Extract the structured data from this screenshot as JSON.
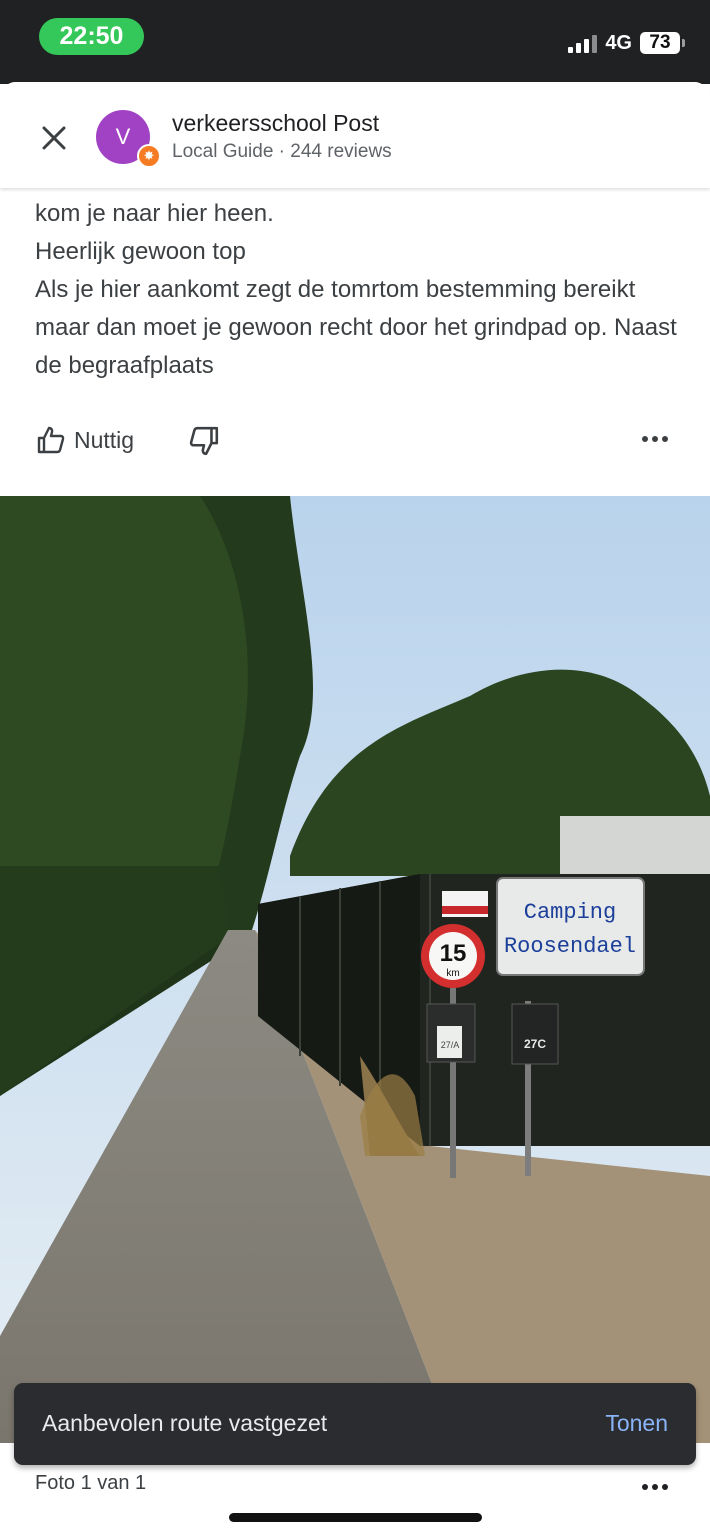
{
  "status_bar": {
    "time": "22:50",
    "network": "4G",
    "battery": "73",
    "colors": {
      "time_pill": "#34c759",
      "background": "#1f2123"
    }
  },
  "header": {
    "avatar_letter": "V",
    "author_name": "verkeersschool Post",
    "author_meta": "Local Guide · 244 reviews",
    "avatar_color": "#a142c4",
    "badge_color": "#f57c23",
    "icons": {
      "close": "close-icon",
      "badge": "local-guide-badge-icon"
    }
  },
  "review": {
    "text": "stroom en water is daar die alles heeft geïnstalleerd\nkom je naar hier heen.\nHeerlijk gewoon top\nAls je hier aankomt zegt de tomrtom bestemming bereikt maar dan moet je gewoon recht door het grindpad op. Naast de begraafplaats"
  },
  "actions": {
    "helpful_label": "Nuttig",
    "icons": {
      "helpful": "thumbs-up-icon",
      "not_helpful": "thumbs-down-icon",
      "more": "more-horizontal-icon"
    }
  },
  "photo": {
    "sign_line1": "Camping",
    "sign_line2": "Roosendael",
    "speed_limit": "15",
    "speed_unit": "km",
    "mailbox_label": "27C",
    "mailbox_label_left": "27/A"
  },
  "snackbar": {
    "message": "Aanbevolen route vastgezet",
    "action": "Tonen",
    "action_color": "#8ab4f8"
  },
  "footer": {
    "photo_counter": "Foto 1 van 1",
    "icons": {
      "more": "more-horizontal-icon"
    }
  }
}
